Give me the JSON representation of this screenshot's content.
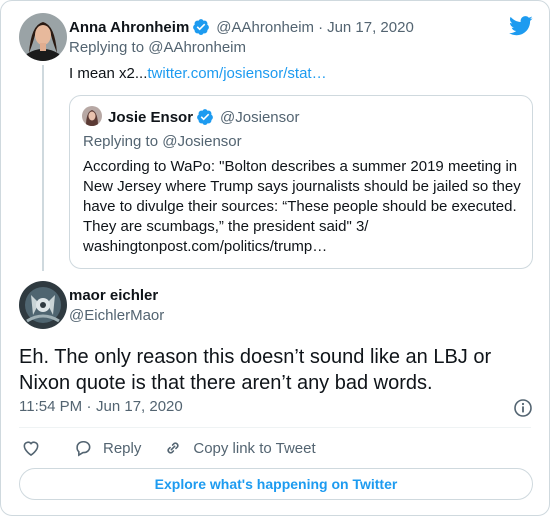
{
  "parent_tweet": {
    "author_name": "Anna Ahronheim",
    "author_handle": "@AAhronheim",
    "separator": "·",
    "date": "Jun 17, 2020",
    "replying_prefix": "Replying to",
    "replying_to": "@AAhronheim",
    "text": "I mean x2...",
    "link": "twitter.com/josiensor/stat…"
  },
  "quoted_tweet": {
    "author_name": "Josie Ensor",
    "author_handle": "@Josiensor",
    "replying_prefix": "Replying to",
    "replying_to": "@Josiensor",
    "text": "According to WaPo: \"Bolton describes a summer 2019 meeting in New Jersey where Trump says journalists should be jailed so they have to divulge their sources: “These people should be executed. They are scumbags,” the president said\" 3/",
    "link": "washingtonpost.com/politics/trump…"
  },
  "main_tweet": {
    "author_name": "maor eichler",
    "author_handle": "@EichlerMaor",
    "text": "Eh. The only reason this doesn’t sound like an LBJ or Nixon quote is that there aren’t any bad words.",
    "time": "11:54 PM",
    "separator": "·",
    "date": "Jun 17, 2020"
  },
  "actions": {
    "reply_label": "Reply",
    "copy_link_label": "Copy link to Tweet"
  },
  "footer": {
    "explore_label": "Explore what's happening on Twitter"
  },
  "icons": {
    "verified": "verified-badge-icon",
    "twitter": "twitter-bird-icon",
    "info": "info-icon",
    "like": "heart-icon",
    "reply": "speech-bubble-icon",
    "copy_link": "link-icon"
  },
  "colors": {
    "accent": "#1d9bf0",
    "text": "#0f1419",
    "secondary": "#536471",
    "border": "#cfd9de"
  }
}
